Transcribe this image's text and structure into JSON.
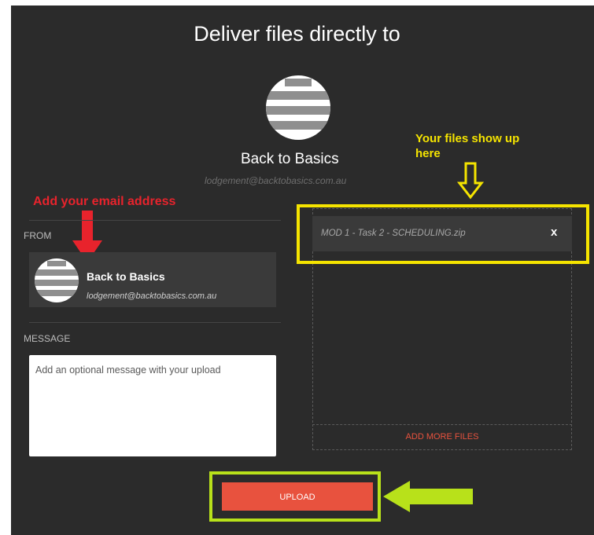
{
  "header": {
    "title": "Deliver files directly to"
  },
  "recipient": {
    "name": "Back to Basics",
    "email": "lodgement@backtobasics.com.au"
  },
  "annotations": {
    "files_hint_line1": "Your files show up",
    "files_hint_line2": "here",
    "email_hint": "Add your email address"
  },
  "form": {
    "from_label": "FROM",
    "sender_name": "Back to Basics",
    "sender_email": "lodgement@backtobasics.com.au",
    "message_label": "MESSAGE",
    "message_placeholder": "Add an optional message with your upload",
    "message_value": ""
  },
  "files": {
    "items": [
      {
        "name": "MOD 1 - Task 2 - SCHEDULING.zip",
        "remove_label": "x"
      }
    ],
    "add_more_label": "ADD MORE FILES"
  },
  "actions": {
    "upload_label": "UPLOAD"
  },
  "colors": {
    "background": "#2b2b2b",
    "accent": "#e8523e",
    "highlight_yellow": "#f5e400",
    "highlight_green": "#b8e11a",
    "annotation_red": "#e8232c"
  },
  "icons": {
    "avatar": "avatar-icon",
    "arrow_down_yellow": "arrow-down-icon",
    "arrow_down_red": "arrow-down-icon",
    "arrow_left_green": "arrow-left-icon",
    "remove": "close-icon"
  }
}
